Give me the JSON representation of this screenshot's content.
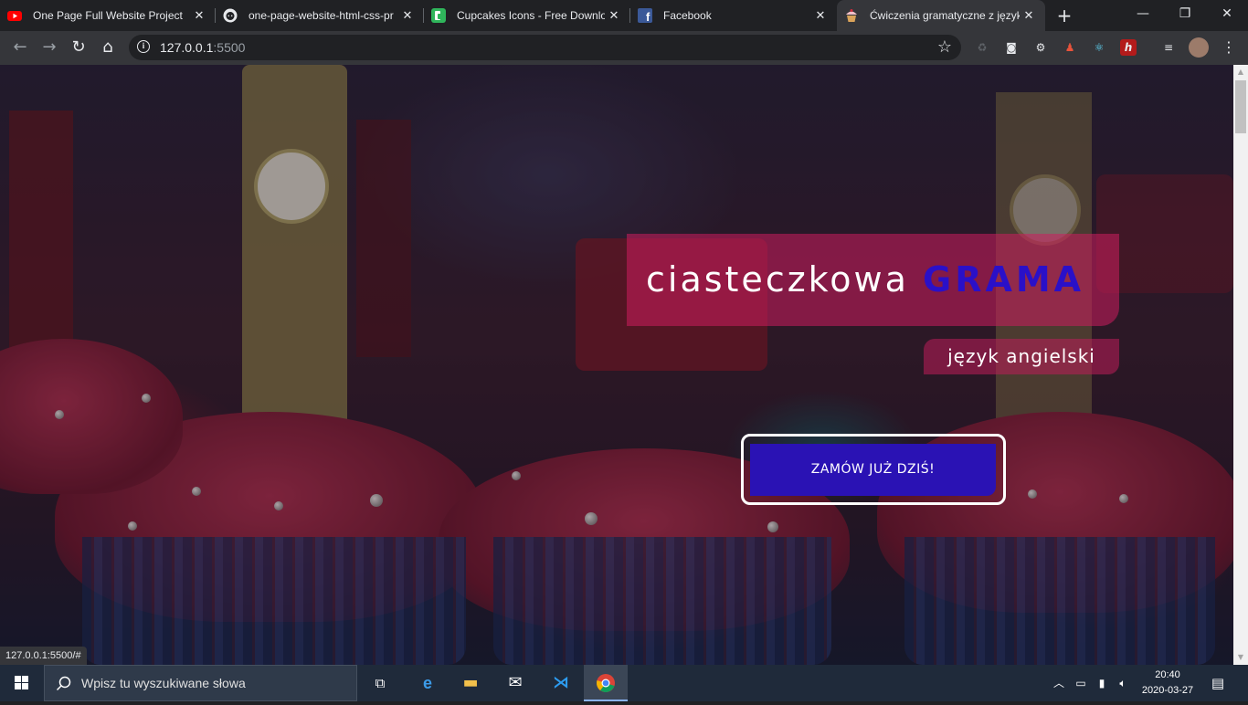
{
  "browser": {
    "tabs": [
      {
        "title": "One Page Full Website Project",
        "favicon": "youtube-icon"
      },
      {
        "title": "one-page-website-html-css-pr",
        "favicon": "github-icon"
      },
      {
        "title": "Cupcakes Icons - Free Downlo",
        "favicon": "icons-site-icon"
      },
      {
        "title": "Facebook",
        "favicon": "facebook-icon"
      },
      {
        "title": "Ćwiczenia gramatyczne z język",
        "favicon": "cupcake-icon",
        "active": true
      }
    ],
    "address": {
      "host": "127.0.0.1",
      "port": ":5500"
    },
    "status_url": "127.0.0.1:5500/#"
  },
  "hero": {
    "title_main": "ciasteczkowa ",
    "title_accent": "GRAMA",
    "subtitle": "język angielski",
    "cta_label": "ZAMÓW JUŻ DZIŚ!"
  },
  "taskbar": {
    "search_placeholder": "Wpisz tu wyszukiwane słowa",
    "time": "20:40",
    "date": "2020-03-27"
  },
  "colors": {
    "accent_blue": "#2a12b4",
    "accent_pink": "#cd1e5f"
  }
}
